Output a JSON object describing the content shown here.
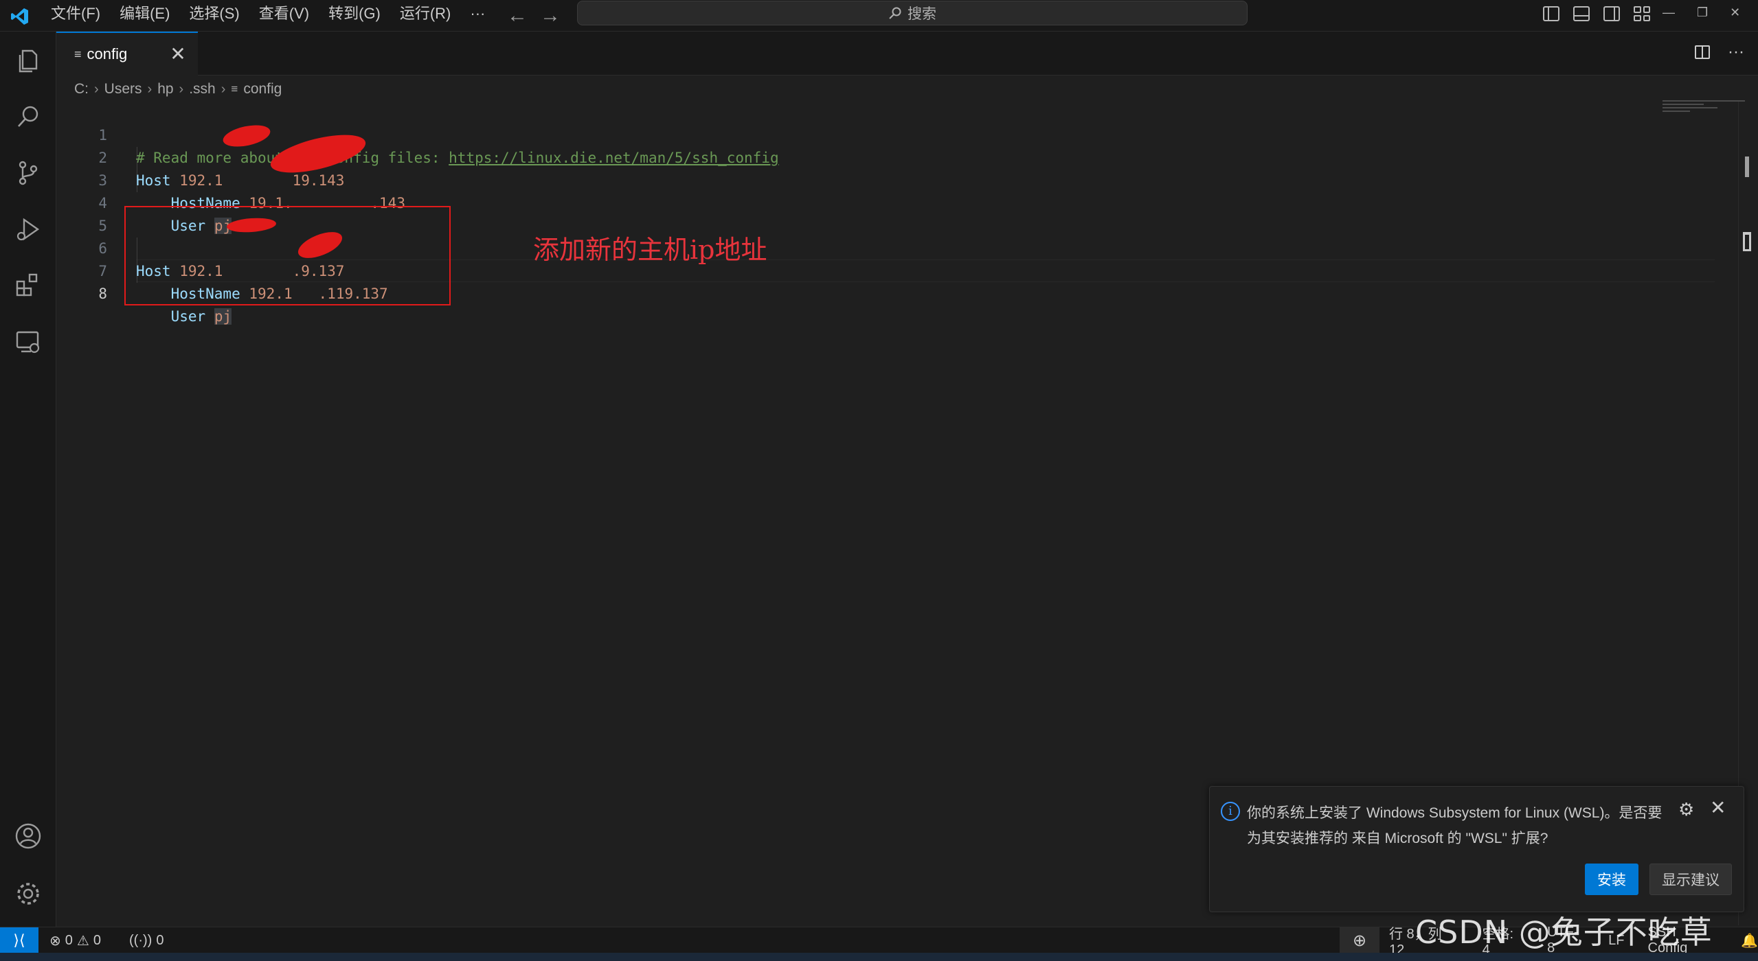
{
  "menubar": {
    "items": [
      "文件(F)",
      "编辑(E)",
      "选择(S)",
      "查看(V)",
      "转到(G)",
      "运行(R)",
      "···"
    ]
  },
  "search": {
    "label": "搜索"
  },
  "tab": {
    "label": "config",
    "close": "✕"
  },
  "breadcrumb": {
    "parts": [
      "C:",
      "Users",
      "hp",
      ".ssh",
      "config"
    ]
  },
  "editor": {
    "lines": [
      {
        "num": "1",
        "comment": "# Read more about SSH config files: ",
        "link": "https://linux.die.net/man/5/ssh_config"
      },
      {
        "num": "2",
        "key": "Host",
        "value": "192.1        19.143"
      },
      {
        "num": "3",
        "key": "HostName",
        "value": "19.1.         .143"
      },
      {
        "num": "4",
        "key": "User",
        "value": "pj"
      },
      {
        "num": "5"
      },
      {
        "num": "6",
        "key": "Host",
        "value": "192.1        .9.137"
      },
      {
        "num": "7",
        "key": "HostName",
        "value": "192.1   .119.137"
      },
      {
        "num": "8",
        "key": "User",
        "value": "pj"
      }
    ]
  },
  "annotation": {
    "text": "添加新的主机ip地址",
    "color": "#e8343c"
  },
  "notification": {
    "message": "你的系统上安装了 Windows Subsystem for Linux (WSL)。是否要为其安装推荐的 来自 Microsoft 的 \"WSL\" 扩展?",
    "install_label": "安装",
    "show_label": "显示建议"
  },
  "statusbar": {
    "errors": "0",
    "warnings": "0",
    "ports": "0",
    "position": "行 8，列 12",
    "spaces": "空格: 4",
    "encoding": "UTF-8",
    "eol": "LF",
    "language": "SSH Config"
  },
  "watermark": "CSDN @兔子不吃草",
  "colors": {
    "accent": "#0078d4",
    "background": "#1f1f1f",
    "annotation_red": "#e11a1a"
  }
}
